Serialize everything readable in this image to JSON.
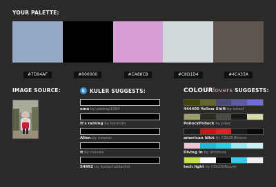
{
  "palette": {
    "heading": "YOUR PALETTE:",
    "swatches": [
      {
        "hex": "#7D94AF",
        "color": "#94A9C3"
      },
      {
        "hex": "#000000",
        "color": "#000000"
      },
      {
        "hex": "#CA88C8",
        "color": "#D89ED6"
      },
      {
        "hex": "#C8D1D4",
        "color": "#D2DADD"
      },
      {
        "hex": "#4C433A",
        "color": "#5E564E"
      }
    ]
  },
  "image_source": {
    "heading": "IMAGE SOURCE:"
  },
  "kuler": {
    "heading": "KULER SUGGESTS:",
    "logo_glyph": "k",
    "by_word": "by",
    "items": [
      {
        "name": "emo",
        "author": "peekay1994"
      },
      {
        "name": "It's raining",
        "author": "koralute"
      },
      {
        "name": "Alien",
        "author": "movies"
      },
      {
        "name": "it",
        "author": "movies"
      },
      {
        "name": "54992",
        "author": "itsiderfulideriful"
      }
    ]
  },
  "colourlovers": {
    "heading_brand": "COLOUR",
    "heading_brand_suffix": "lovers",
    "heading_rest": " SUGGESTS:",
    "by_word": "by",
    "items": [
      {
        "name": "444400 Yellow Shift",
        "author": "retsof",
        "colors": [
          "#444400",
          "#66662a",
          "#4a4a7a",
          "#5b5ba8",
          "#6e6ed6"
        ]
      },
      {
        "name": "PollockPollock",
        "author": "Julee",
        "colors": [
          "#9da06b",
          "#2a2a20",
          "#4a4a44",
          "#1a1a18",
          "#d6dba6"
        ]
      },
      {
        "name": "american idiot",
        "author": "COLOURlover",
        "colors": [
          "#1a1a1a",
          "#c8141a",
          "#e01e24",
          "#1a1a1a",
          "#0a0a0a"
        ]
      },
      {
        "name": "Diving In",
        "author": "afrodusa",
        "colors": [
          "#f0c4d2",
          "#1fb8d6",
          "#2ad0e6",
          "#9ae8f0",
          "#c8f2f6"
        ]
      },
      {
        "name": "tech light",
        "author": "COLOURlover",
        "colors": [
          "#c8e040",
          "#ffffff",
          "#0a0a0a",
          "#2ed0f0",
          "#f0f0f0"
        ]
      }
    ]
  }
}
